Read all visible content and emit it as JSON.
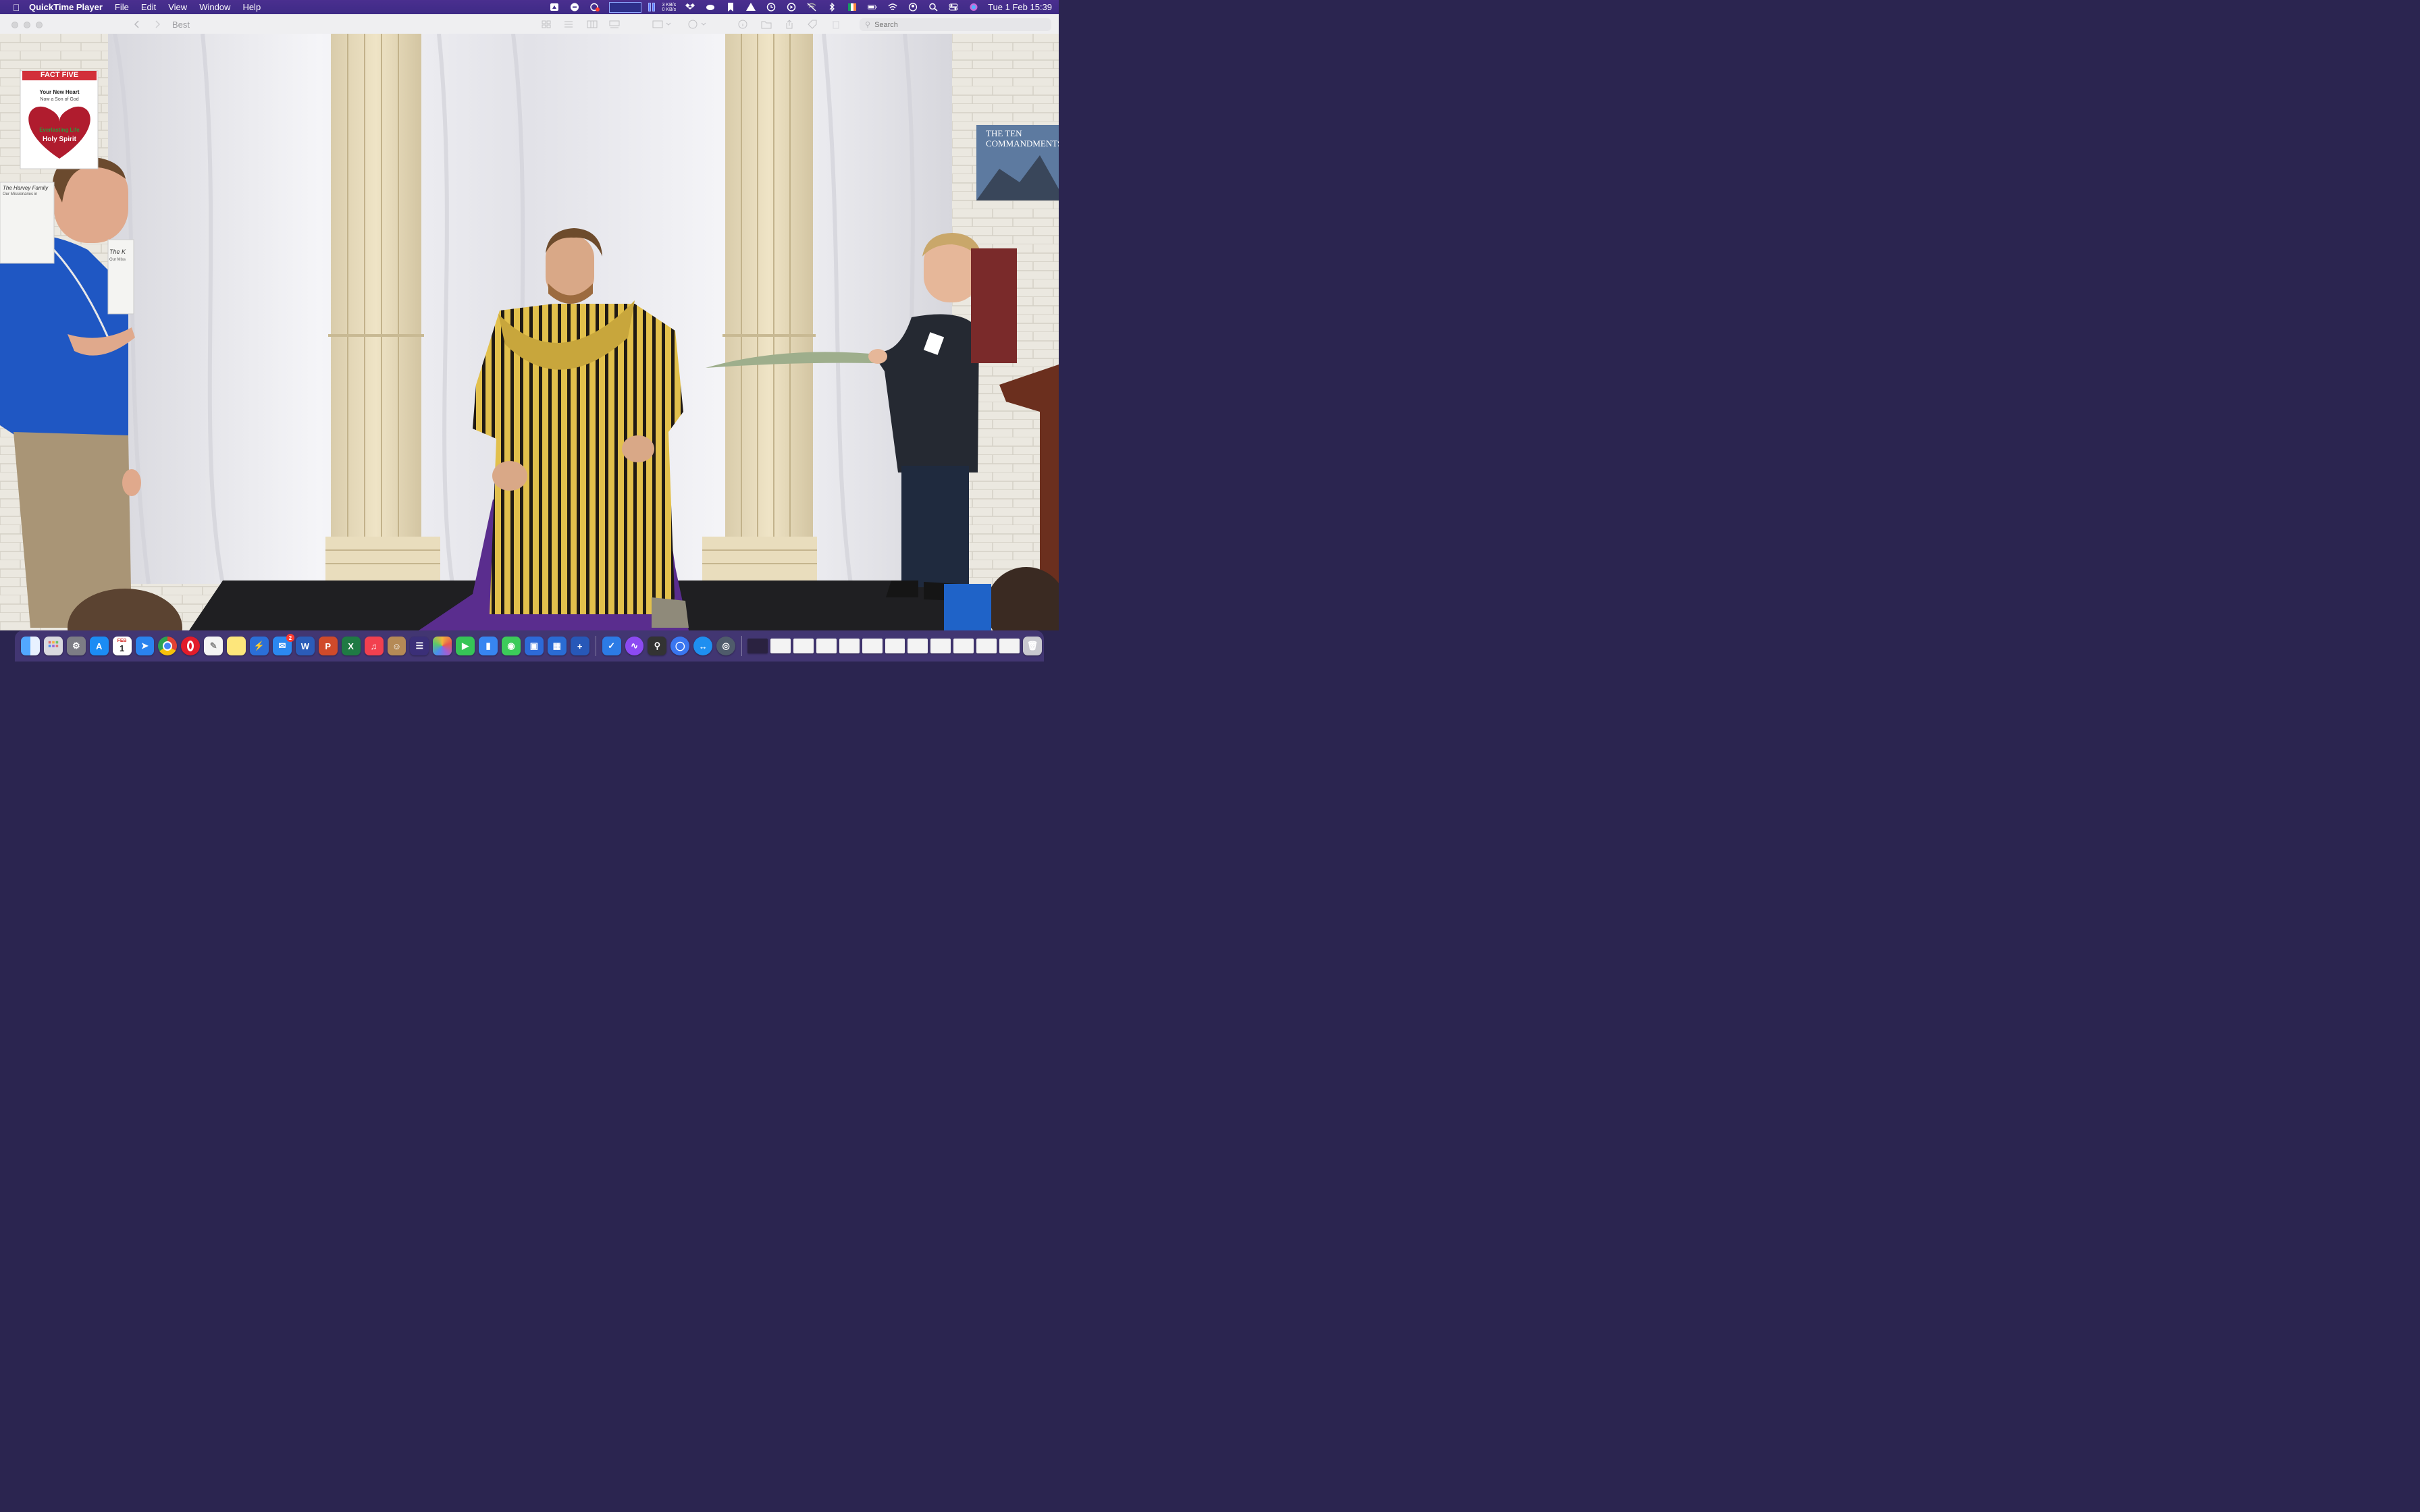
{
  "menubar": {
    "app_name": "QuickTime Player",
    "menus": [
      "File",
      "Edit",
      "View",
      "Window",
      "Help"
    ],
    "network": {
      "up": "3 KB/s",
      "down": "0 KB/s"
    },
    "clock": "Tue 1 Feb  15:39"
  },
  "window": {
    "title": "Best",
    "search_placeholder": "Search"
  },
  "video": {
    "posters": {
      "fact_five": {
        "header": "FACT FIVE",
        "line1": "Your New Heart",
        "line2": "Now a Son of God",
        "heart_line1": "Everlasting Life",
        "heart_line2": "Holy Spirit"
      },
      "harvey": {
        "title": "The Harvey Family",
        "subtitle": "Our Missionaries in"
      },
      "k_poster": {
        "title": "The K",
        "subtitle": "Our Miss"
      },
      "ten_commandments": {
        "line1": "THE TEN",
        "line2": "COMMANDMENTS"
      }
    }
  },
  "dock": {
    "calendar_month": "FEB",
    "calendar_day": "1",
    "mail_badge": "2",
    "apps": [
      "finder",
      "launchpad",
      "system-preferences",
      "app-store",
      "safari",
      "chrome",
      "opera",
      "textedit",
      "notes",
      "vpn",
      "mail",
      "word",
      "powerpoint",
      "excel",
      "music",
      "contacts",
      "tunnel",
      "photos",
      "facetime",
      "readwise",
      "messages",
      "teamviewer",
      "screen-share",
      "contact-add",
      "things",
      "messenger",
      "alfred",
      "signal",
      "teamviewer-2",
      "qr-scanner"
    ]
  },
  "colors": {
    "menubar": "#412d8a",
    "accent_blue": "#1f57c3",
    "robe_yellow": "#e3c34a",
    "robe_purple": "#5a2d8e"
  }
}
